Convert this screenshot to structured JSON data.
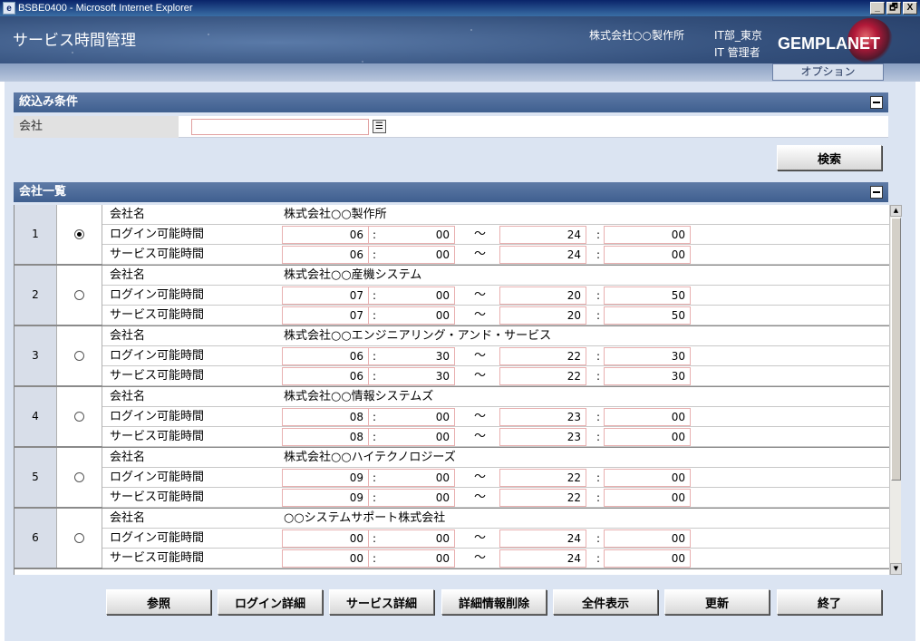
{
  "window": {
    "title": "BSBE0400 - Microsoft Internet Explorer",
    "app_icon": "ie-icon",
    "buttons": [
      "_",
      "🗗",
      "X"
    ]
  },
  "header": {
    "app_title": "サービス時間管理",
    "company": "株式会社○○製作所",
    "department": "IT部_東京",
    "user": "IT 管理者",
    "brand": "GEMPLANET",
    "options_tab": "オプション"
  },
  "filter": {
    "section_title": "絞込み条件",
    "company_label": "会社",
    "company_value": "",
    "search_button": "検索"
  },
  "company_list": {
    "section_title": "会社一覧",
    "name_label": "会社名",
    "login_label": "ログイン可能時間",
    "service_label": "サービス可能時間",
    "colon": ":",
    "tilde": "～",
    "rows": [
      {
        "no": "1",
        "selected": true,
        "name": "株式会社○○製作所",
        "login": [
          "06",
          "00",
          "24",
          "00"
        ],
        "service": [
          "06",
          "00",
          "24",
          "00"
        ]
      },
      {
        "no": "2",
        "selected": false,
        "name": "株式会社○○産機システム",
        "login": [
          "07",
          "00",
          "20",
          "50"
        ],
        "service": [
          "07",
          "00",
          "20",
          "50"
        ]
      },
      {
        "no": "3",
        "selected": false,
        "name": "株式会社○○エンジニアリング・アンド・サービス",
        "login": [
          "06",
          "30",
          "22",
          "30"
        ],
        "service": [
          "06",
          "30",
          "22",
          "30"
        ]
      },
      {
        "no": "4",
        "selected": false,
        "name": "株式会社○○情報システムズ",
        "login": [
          "08",
          "00",
          "23",
          "00"
        ],
        "service": [
          "08",
          "00",
          "23",
          "00"
        ]
      },
      {
        "no": "5",
        "selected": false,
        "name": "株式会社○○ハイテクノロジーズ",
        "login": [
          "09",
          "00",
          "22",
          "00"
        ],
        "service": [
          "09",
          "00",
          "22",
          "00"
        ]
      },
      {
        "no": "6",
        "selected": false,
        "name": "○○システムサポート株式会社",
        "login": [
          "00",
          "00",
          "24",
          "00"
        ],
        "service": [
          "00",
          "00",
          "24",
          "00"
        ]
      }
    ]
  },
  "footer_buttons": {
    "refer": "参照",
    "login_detail": "ログイン詳細",
    "service_detail": "サービス詳細",
    "delete_detail": "詳細情報削除",
    "show_all": "全件表示",
    "update": "更新",
    "exit": "終了"
  }
}
